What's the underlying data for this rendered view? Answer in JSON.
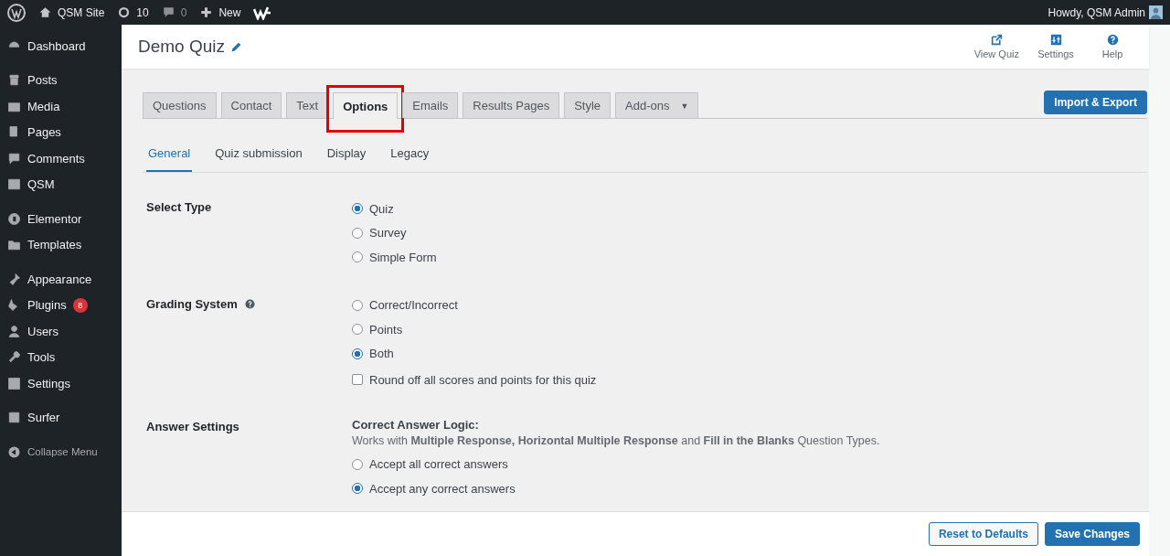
{
  "admin_bar": {
    "site": "QSM Site",
    "updates": "10",
    "comments": "0",
    "new": "New",
    "greeting": "Howdy, QSM Admin"
  },
  "sidebar": {
    "groups": [
      [
        {
          "label": "Dashboard"
        }
      ],
      [
        {
          "label": "Posts"
        },
        {
          "label": "Media"
        },
        {
          "label": "Pages"
        },
        {
          "label": "Comments"
        },
        {
          "label": "QSM"
        }
      ],
      [
        {
          "label": "Elementor"
        },
        {
          "label": "Templates"
        }
      ],
      [
        {
          "label": "Appearance"
        },
        {
          "label": "Plugins",
          "badge": "8"
        },
        {
          "label": "Users"
        },
        {
          "label": "Tools"
        },
        {
          "label": "Settings"
        }
      ],
      [
        {
          "label": "Surfer"
        }
      ]
    ],
    "collapse": "Collapse Menu"
  },
  "header": {
    "title": "Demo Quiz",
    "actions": [
      "View Quiz",
      "Settings",
      "Help"
    ]
  },
  "tabs": [
    {
      "label": "Questions",
      "selected": false,
      "highlighted": false
    },
    {
      "label": "Contact",
      "selected": false,
      "highlighted": false
    },
    {
      "label": "Text",
      "selected": false,
      "highlighted": false
    },
    {
      "label": "Options",
      "selected": true,
      "highlighted": true
    },
    {
      "label": "Emails",
      "selected": false,
      "highlighted": false
    },
    {
      "label": "Results Pages",
      "selected": false,
      "highlighted": false
    },
    {
      "label": "Style",
      "selected": false,
      "highlighted": false
    },
    {
      "label": "Add-ons",
      "selected": false,
      "highlighted": false,
      "dropdown": "▼"
    }
  ],
  "import_export": "Import & Export",
  "subtabs": [
    {
      "label": "General",
      "selected": true
    },
    {
      "label": "Quiz submission",
      "selected": false
    },
    {
      "label": "Display",
      "selected": false
    },
    {
      "label": "Legacy",
      "selected": false
    }
  ],
  "sections": [
    {
      "label": "Select Type",
      "items": [
        {
          "kind": "radio",
          "label": "Quiz",
          "selected": true
        },
        {
          "kind": "radio",
          "label": "Survey",
          "selected": false
        },
        {
          "kind": "radio",
          "label": "Simple Form",
          "selected": false
        }
      ]
    },
    {
      "label": "Grading System",
      "help": true,
      "items": [
        {
          "kind": "radio",
          "label": "Correct/Incorrect",
          "selected": false
        },
        {
          "kind": "radio",
          "label": "Points",
          "selected": false
        },
        {
          "kind": "radio",
          "label": "Both",
          "selected": true
        },
        {
          "kind": "checkbox",
          "label": "Round off all scores and points for this quiz",
          "checked": false
        }
      ]
    },
    {
      "label": "Answer Settings",
      "items": [
        {
          "kind": "heading",
          "label": "Correct Answer Logic:"
        },
        {
          "kind": "note",
          "label": "Works with **Multiple Response, Horizontal Multiple Response** and **Fill in the Blanks** Question Types."
        },
        {
          "kind": "radio",
          "label": "Accept all correct answers",
          "selected": false
        },
        {
          "kind": "radio",
          "label": "Accept any correct answers",
          "selected": true
        }
      ]
    }
  ],
  "footer": {
    "reset": "Reset to Defaults",
    "save": "Save Changes"
  }
}
